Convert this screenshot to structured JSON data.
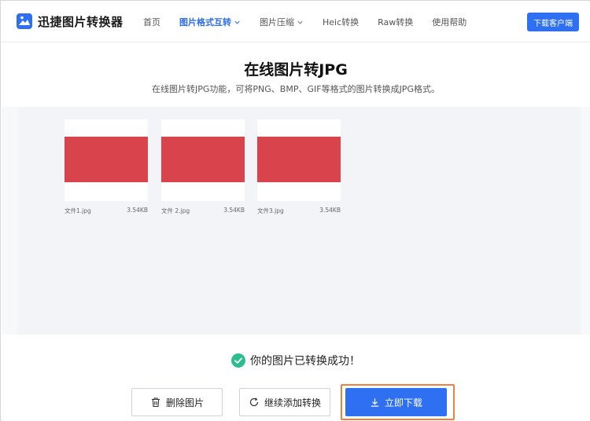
{
  "app": {
    "logo_text": "迅捷图片转换器",
    "download_client": "下载客户端"
  },
  "nav": [
    {
      "label": "首页",
      "active": false,
      "dropdown": false
    },
    {
      "label": "图片格式互转",
      "active": true,
      "dropdown": true
    },
    {
      "label": "图片压缩",
      "active": false,
      "dropdown": true
    },
    {
      "label": "Heic转换",
      "active": false,
      "dropdown": false
    },
    {
      "label": "Raw转换",
      "active": false,
      "dropdown": false
    },
    {
      "label": "使用帮助",
      "active": false,
      "dropdown": false
    }
  ],
  "hero": {
    "title": "在线图片转JPG",
    "subtitle": "在线图片转JPG功能，可将PNG、BMP、GIF等格式的图片转换成JPG格式。"
  },
  "files": [
    {
      "name": "文件1.jpg",
      "size": "3.54KB"
    },
    {
      "name": "文件 2.jpg",
      "size": "3.54KB"
    },
    {
      "name": "文件3.jpg",
      "size": "3.54KB"
    }
  ],
  "status": {
    "message": "你的图片已转换成功！"
  },
  "actions": {
    "delete": "删除图片",
    "continue": "继续添加转换",
    "download": "立即下载"
  },
  "colors": {
    "primary": "#2f6ff2",
    "thumbnail": "#d9434b",
    "success": "#2bbd8e",
    "highlight": "#f0803c"
  }
}
